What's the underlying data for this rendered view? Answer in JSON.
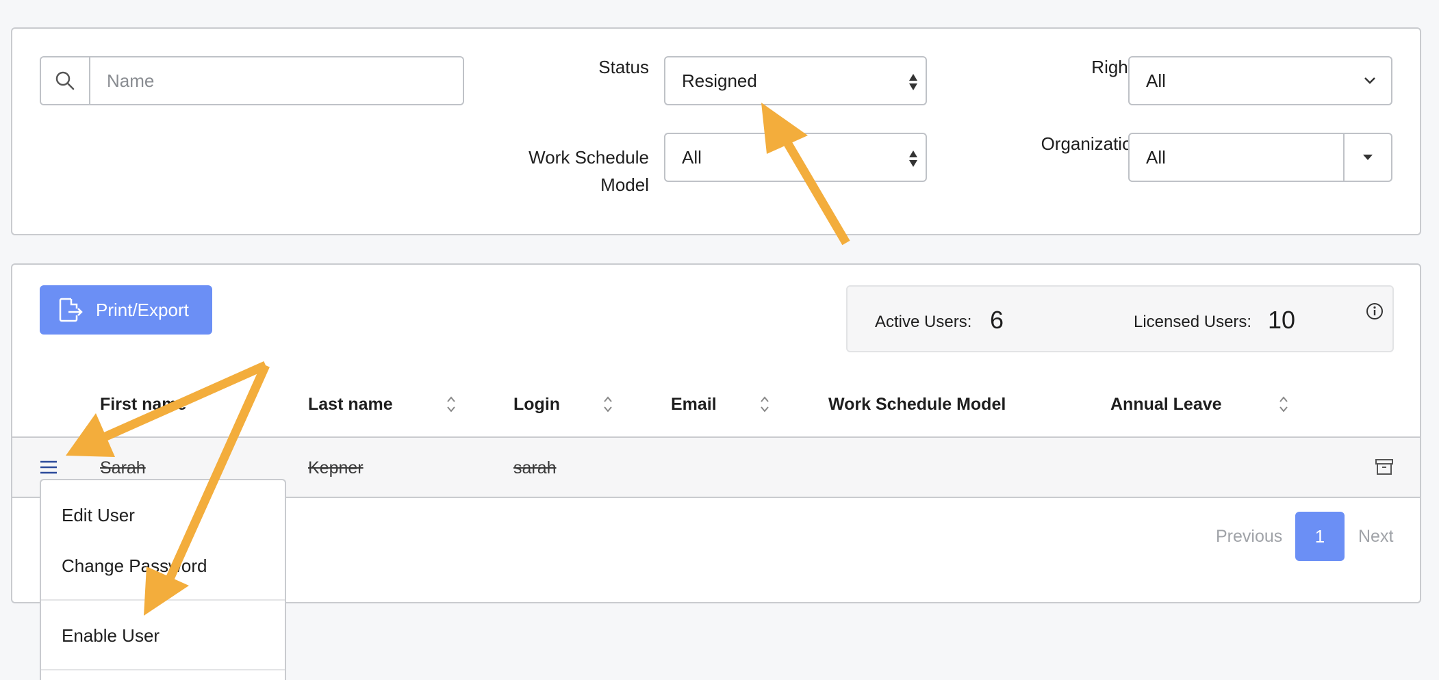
{
  "filters": {
    "search_placeholder": "Name",
    "status_label": "Status",
    "status_value": "Resigned",
    "rights_label": "Rights",
    "rights_value": "All",
    "work_schedule_label_line1": "Work Schedule",
    "work_schedule_label_line2": "Model",
    "work_schedule_value": "All",
    "organization_label": "Organization",
    "organization_value": "All"
  },
  "toolbar": {
    "export_label": "Print/Export"
  },
  "stats": {
    "active_label": "Active Users:",
    "active_value": "6",
    "licensed_label": "Licensed Users:",
    "licensed_value": "10"
  },
  "table": {
    "columns": [
      "First name",
      "Last name",
      "Login",
      "Email",
      "Work Schedule Model",
      "Annual Leave"
    ],
    "rows": [
      {
        "first_name": "Sarah",
        "last_name": "Kepner",
        "login": "sarah",
        "email": "",
        "work_schedule": "",
        "annual_leave": ""
      }
    ]
  },
  "pager": {
    "previous": "Previous",
    "current_page": "1",
    "next": "Next"
  },
  "context_menu": {
    "items": [
      "Edit User",
      "Change Password",
      "Enable User"
    ]
  },
  "colors": {
    "accent": "#6b8ff5",
    "annotation_arrow": "#f3ad3c"
  },
  "icons": [
    "search-icon",
    "sort-updown-icon",
    "chevron-down-icon",
    "caret-down-icon",
    "export-icon",
    "info-icon",
    "hamburger-menu-icon",
    "archive-icon"
  ]
}
